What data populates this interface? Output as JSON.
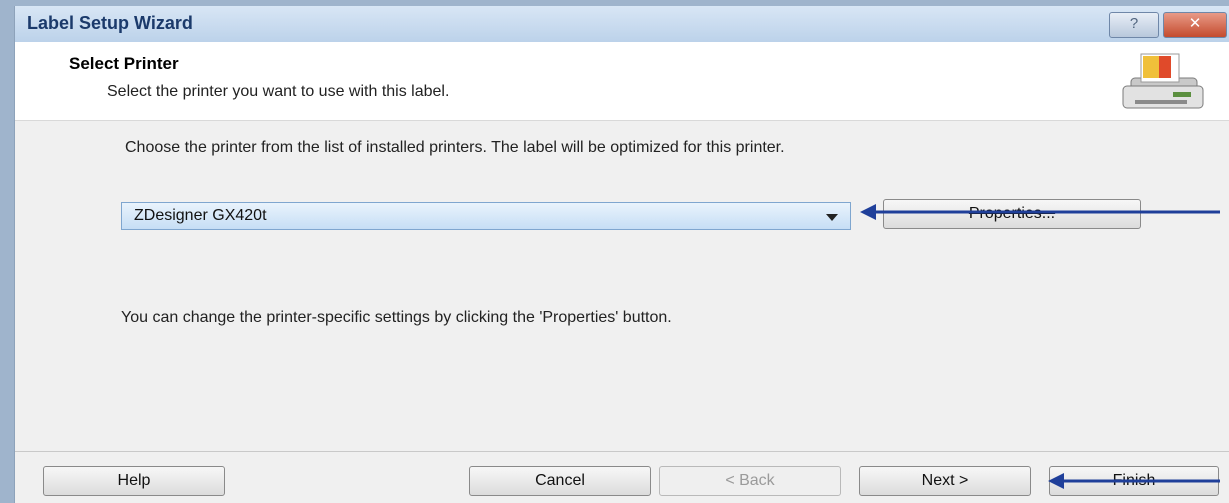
{
  "window": {
    "title": "Label Setup Wizard",
    "help_button": "?",
    "close_button": "✕"
  },
  "header": {
    "title": "Select Printer",
    "subtitle": "Select the printer you want to use with this label.",
    "icon": "printer-icon"
  },
  "body": {
    "instruction": "Choose the printer from the list of installed printers. The label will be optimized for this printer.",
    "printer_select": {
      "selected": "ZDesigner GX420t"
    },
    "properties_button": "Properties...",
    "hint": "You can change the printer-specific settings by clicking the 'Properties' button."
  },
  "footer": {
    "help": "Help",
    "cancel": "Cancel",
    "back": "< Back",
    "next": "Next >",
    "finish": "Finish"
  },
  "colors": {
    "annotation_arrow": "#1f3f9a",
    "title_text": "#1b3a6b"
  }
}
